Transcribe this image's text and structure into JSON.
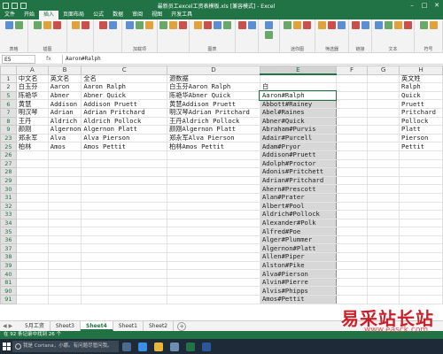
{
  "window": {
    "title": "最新员工excel工资表模板.xls [兼容模式] - Excel"
  },
  "ribbon": {
    "tabs": [
      "文件",
      "开始",
      "插入",
      "页面布局",
      "公式",
      "数据",
      "审阅",
      "视图",
      "开发工具"
    ],
    "active_tab": "插入",
    "groups": [
      "表格",
      "插图",
      "",
      "",
      "加载项",
      "",
      "图表",
      "",
      "",
      "迷你图",
      "筛选器",
      "链接",
      "文本",
      "符号"
    ]
  },
  "formula_bar": {
    "name_box": "E5",
    "fx": "fx",
    "value": "Aaron#Ralph"
  },
  "columns": [
    "A",
    "B",
    "C",
    "D",
    "E",
    "F",
    "G",
    "H"
  ],
  "header_row": {
    "num": "1",
    "a": "中文名",
    "b": "英文名",
    "c": "全名",
    "d": "源数据",
    "e": "",
    "h": "英文姓"
  },
  "row2": {
    "num": "2",
    "a": "白玉芬",
    "b": "Aaron",
    "c": "Aaron Ralph",
    "d": "白玉芬Aaron Ralph",
    "e": "白",
    "h": "Ralph"
  },
  "rows": [
    {
      "num": "5",
      "a": "陈艳华",
      "b": "Abner",
      "c": "Abner Quick",
      "d": "陈艳华Abner Quick",
      "e": "Aaron#Ralph",
      "h": "Quick"
    },
    {
      "num": "6",
      "a": "黄慧",
      "b": "Addison",
      "c": "Addison Pruett",
      "d": "黄慧Addison Pruett",
      "e": "Abbott#Rainey",
      "h": "Pruett"
    },
    {
      "num": "7",
      "a": "明汉琴",
      "b": "Adrian",
      "c": "Adrian Pritchard",
      "d": "明汉琴Adrian Pritchard",
      "e": "Abel#Raines",
      "h": "Pritchard"
    },
    {
      "num": "8",
      "a": "王丹",
      "b": "Aldrich",
      "c": "Aldrich Pollock",
      "d": "王丹Aldrich Pollock",
      "e": "Abner#Quick",
      "h": "Pollock"
    },
    {
      "num": "9",
      "a": "颜刚",
      "b": "Algernon",
      "c": "Algernon Platt",
      "d": "颜刚Algernon Platt",
      "e": "Abraham#Purvis",
      "h": "Platt"
    },
    {
      "num": "23",
      "a": "郑永军",
      "b": "Alva",
      "c": "Alva Pierson",
      "d": "郑永军Alva Pierson",
      "e": "Adair#Purcell",
      "h": "Pierson"
    },
    {
      "num": "25",
      "a": "柏林",
      "b": "Amos",
      "c": "Amos Pettit",
      "d": "柏林Amos Pettit",
      "e": "Adam#Pryor",
      "h": "Pettit"
    }
  ],
  "e_list": [
    {
      "num": "26",
      "e": "Addison#Pruett"
    },
    {
      "num": "27",
      "e": "Adolph#Proctor"
    },
    {
      "num": "28",
      "e": "Adonis#Pritchett"
    },
    {
      "num": "29",
      "e": "Adrian#Pritchard"
    },
    {
      "num": "30",
      "e": "Ahern#Prescott"
    },
    {
      "num": "31",
      "e": "Alan#Prater"
    },
    {
      "num": "32",
      "e": "Albert#Pool"
    },
    {
      "num": "33",
      "e": "Aldrich#Pollock"
    },
    {
      "num": "34",
      "e": "Alexander#Polk"
    },
    {
      "num": "35",
      "e": "Alfred#Poe"
    },
    {
      "num": "36",
      "e": "Alger#Plummer"
    },
    {
      "num": "37",
      "e": "Algernon#Platt"
    },
    {
      "num": "38",
      "e": "Allen#Piper"
    },
    {
      "num": "39",
      "e": "Alston#Pike"
    },
    {
      "num": "40",
      "e": "Alva#Pierson"
    },
    {
      "num": "81",
      "e": "Alvin#Pierre"
    },
    {
      "num": "90",
      "e": "Alvis#Phipps"
    },
    {
      "num": "91",
      "e": "Amos#Pettit"
    }
  ],
  "sheet_tabs": [
    "5月工资",
    "Sheet3",
    "Sheet4",
    "Sheet1",
    "Sheet2"
  ],
  "active_sheet": "Sheet4",
  "add_sheet": "+",
  "status": {
    "text": "在 92 条记录中找到 26 个"
  },
  "taskbar": {
    "search_placeholder": "我是 Cortana，小娜。有问题尽管问我。"
  },
  "watermark": {
    "main": "易采站长站",
    "sub": "www.easck.com"
  },
  "colors": {
    "accent": "#217346",
    "selection": "#d7d7d7"
  }
}
